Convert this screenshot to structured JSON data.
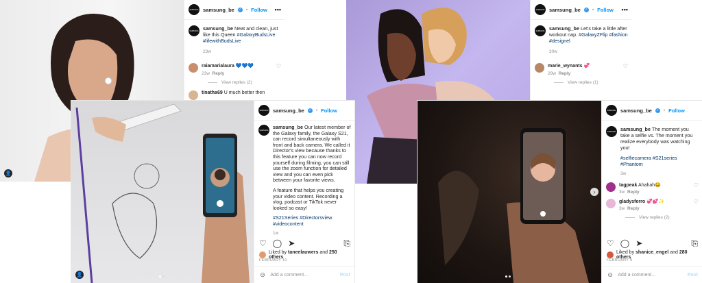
{
  "brand": {
    "logo_text": "SAMSUNG",
    "verified_glyph": "✓",
    "more_glyph": "•••",
    "follow_label": "Follow",
    "accent": "#0095f6"
  },
  "post1": {
    "username": "samsung_be",
    "caption": "Neat and clean, just like this Queen",
    "hashtags": "#GalaxyBudsLive #lifewithBudsLive",
    "caption_time": "23w",
    "comments": [
      {
        "user": "raiamarialaura",
        "text": "💙💙💙",
        "time": "23w",
        "reply": "Reply"
      },
      {
        "user": "tinatha69",
        "text": "U much better then"
      }
    ],
    "view_replies": "View replies (2)"
  },
  "post2": {
    "username": "samsung_be",
    "caption": "Let's take a little after workout nap.",
    "hashtags": "#GalaxyZFlip #fashion #designel",
    "caption_time": "30w",
    "comments": [
      {
        "user": "marie_wynants",
        "text": "💞",
        "time": "29w",
        "reply": "Reply"
      }
    ],
    "view_replies": "View replies (1)"
  },
  "post3": {
    "username": "samsung_be",
    "caption": "Our latest member of the Galaxy family, the Galaxy S21, can record simultaneously with front and back camera. We called it Director's view because thanks to this feature you can now record yourself during filming, you can still use the zoom function for detailed view and you can even pick between your favorite views.",
    "caption_2": "A feature that helps you creating your video content. Recording a vlog, podcast or TikTok never looked so easy!",
    "hashtags": "#S21Series #Directorsview #videocontent",
    "caption_time": "1w",
    "liked_by_prefix": "Liked by",
    "liked_by_user": "taneelauwers",
    "liked_by_suffix": "and",
    "liked_by_others": "250 others",
    "date": "FEBRUARY 10",
    "add_comment": "Add a comment...",
    "post_label": "Post"
  },
  "post4": {
    "username": "samsung_be",
    "caption": "The moment you take a selfie vs. The moment you realize everybody was watching you!",
    "hashtags": "#selfiecamera #S21series #Phantom",
    "caption_time": "3w",
    "comments": [
      {
        "user": "tagpeak",
        "text": "Ahahah😂",
        "time": "3w",
        "reply": "Reply"
      },
      {
        "user": "gladysferro",
        "text": "💞💕✨",
        "time": "3w",
        "reply": "Reply"
      }
    ],
    "view_replies": "View replies (2)",
    "liked_by_prefix": "Liked by",
    "liked_by_user": "shanice_engel",
    "liked_by_suffix": "and",
    "liked_by_others": "280 others",
    "date": "FEBRUARY 9",
    "add_comment": "Add a comment...",
    "post_label": "Post"
  },
  "icons": {
    "heart": "♡",
    "comment": "◯",
    "share": "➤",
    "save": "⎘",
    "emoji": "☺",
    "user": "👤",
    "next": "›"
  }
}
